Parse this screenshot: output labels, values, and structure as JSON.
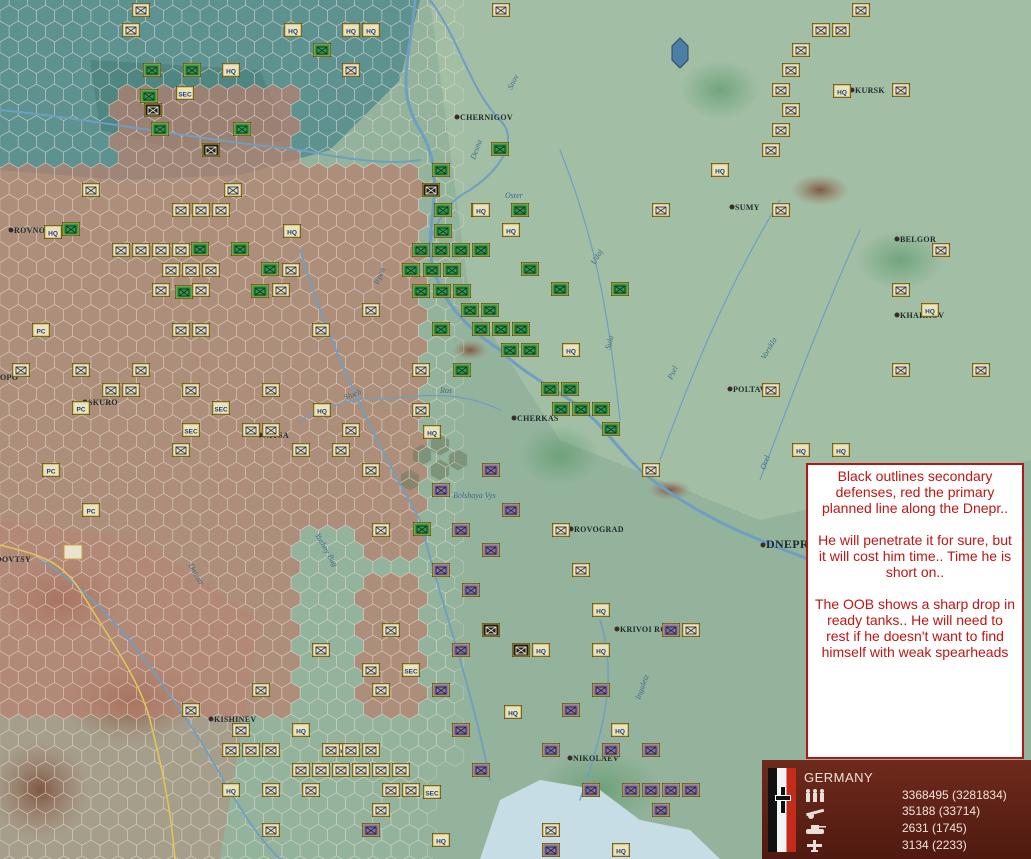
{
  "cities": [
    {
      "name": "CHERNIGOV"
    },
    {
      "name": "KURSK"
    },
    {
      "name": "SUMY"
    },
    {
      "name": "BELGOR"
    },
    {
      "name": "KHARKOV"
    },
    {
      "name": "POLTAVA"
    },
    {
      "name": "CHERKAS"
    },
    {
      "name": "ROVNO"
    },
    {
      "name": "SKURO"
    },
    {
      "name": "NITSA"
    },
    {
      "name": "ROVOGRAD"
    },
    {
      "name": "KRIVOI ROG"
    },
    {
      "name": "DNEPR"
    },
    {
      "name": "KISHINEV"
    },
    {
      "name": "NIKOLAEV"
    },
    {
      "name": "OVTSY"
    },
    {
      "name": "OPO"
    }
  ],
  "rivers": [
    {
      "name": "Oster"
    },
    {
      "name": "Ros"
    },
    {
      "name": "Sluch"
    },
    {
      "name": "Bolshaya Vys"
    },
    {
      "name": "Yuzhny Bug"
    },
    {
      "name": "Irpen"
    },
    {
      "name": "Sula"
    },
    {
      "name": "Psel"
    },
    {
      "name": "Vorskla"
    },
    {
      "name": "Udaj"
    },
    {
      "name": "Orel"
    },
    {
      "name": "Inguletz"
    },
    {
      "name": "Desna"
    },
    {
      "name": "Snov"
    },
    {
      "name": "Dniestr"
    }
  ],
  "annotation": {
    "p1": "Black outlines secondary defenses, red the primary planned line along the Dnepr..",
    "p2": "He will penetrate it for sure, but it will cost him time.. Time he is short on..",
    "p3": "The OOB shows a sharp drop in ready tanks.. He will need to rest if he doesn't want to find himself with weak spearheads"
  },
  "nation": {
    "name": "GERMANY",
    "men": "3368495 (3281834)",
    "guns": "35188 (33714)",
    "tanks": "2631 (1745)",
    "aircraft": "3134 (2233)"
  },
  "unit_labels": {
    "hq": "HQ",
    "sec": "SEC",
    "pc": "PC"
  },
  "colors": {
    "map_green": "#8fae98",
    "swamp": "#4f8a86",
    "defense_hex": "#b98375",
    "german_counter": "#e9e4cf",
    "soviet_infantry": "#2aa04e",
    "soviet_axis_purple": "#8d72b8",
    "counter_border": "#c6a52c",
    "annotation_red": "#c21414",
    "panel_brown": "#5e2214"
  }
}
